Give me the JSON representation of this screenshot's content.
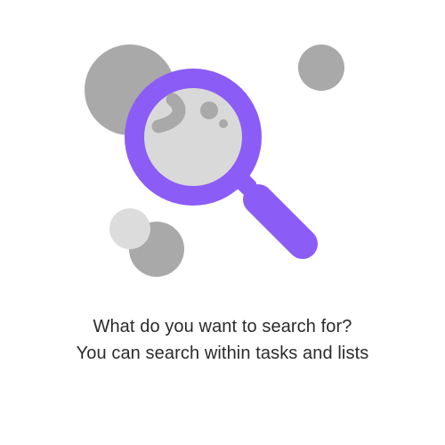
{
  "empty_state": {
    "illustration_icon": "magnifying-glass-icon",
    "line_1": "What do you want to search for?",
    "line_2": "You can search within tasks and lists"
  },
  "colors": {
    "accent": "#8b5cf6",
    "lens_fill": "#d9d9d9",
    "bubble_dark": "#a9a9a9",
    "bubble_light": "#dcdcdc",
    "text": "#2b2b2b"
  }
}
